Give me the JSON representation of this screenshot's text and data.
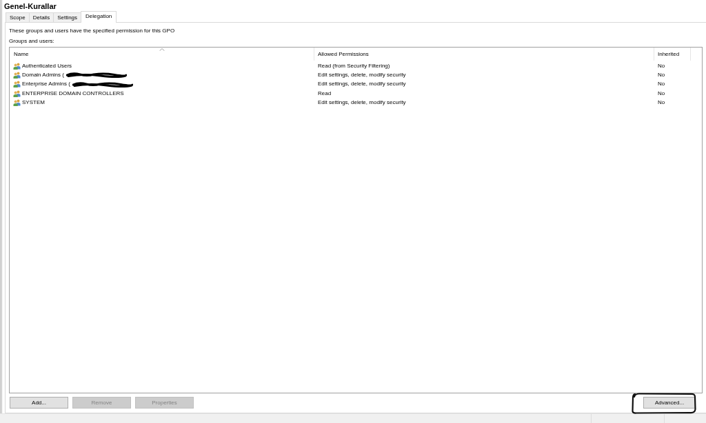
{
  "window": {
    "title": "Genel-Kurallar"
  },
  "tabs": [
    {
      "label": "Scope",
      "selected": false
    },
    {
      "label": "Details",
      "selected": false
    },
    {
      "label": "Settings",
      "selected": false
    },
    {
      "label": "Delegation",
      "selected": true
    }
  ],
  "description": "These groups and users have the specified permission for this GPO",
  "list_label": "Groups and users:",
  "table": {
    "columns": [
      {
        "label": "Name",
        "sorted": true
      },
      {
        "label": "Allowed Permissions",
        "sorted": false
      },
      {
        "label": "Inherited",
        "sorted": false
      }
    ],
    "rows": [
      {
        "name": "Authenticated Users",
        "redacted": false,
        "permissions": "Read (from Security Filtering)",
        "inherited": "No"
      },
      {
        "name": "Domain Admins (",
        "redacted": true,
        "permissions": "Edit settings, delete, modify security",
        "inherited": "No"
      },
      {
        "name": "Enterprise Admins (",
        "redacted": true,
        "permissions": "Edit settings, delete, modify security",
        "inherited": "No"
      },
      {
        "name": "ENTERPRISE DOMAIN CONTROLLERS",
        "redacted": false,
        "permissions": "Read",
        "inherited": "No"
      },
      {
        "name": "SYSTEM",
        "redacted": false,
        "permissions": "Edit settings, delete, modify security",
        "inherited": "No"
      }
    ]
  },
  "buttons": [
    {
      "label": "Add...",
      "disabled": false,
      "highlighted": false
    },
    {
      "label": "Remove",
      "disabled": true,
      "highlighted": false
    },
    {
      "label": "Properties",
      "disabled": true,
      "highlighted": false
    }
  ],
  "side_buttons": [
    {
      "label": "Advanced...",
      "disabled": false,
      "highlighted": true
    }
  ]
}
